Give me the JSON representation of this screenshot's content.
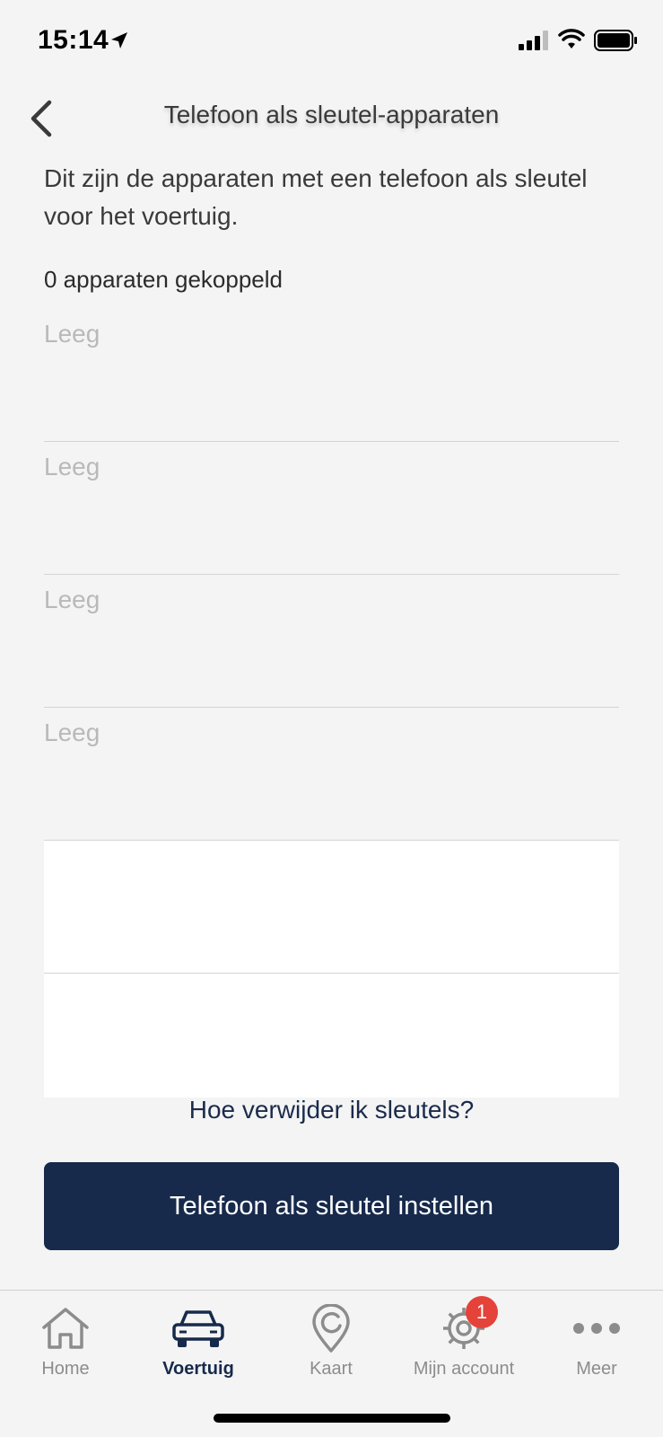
{
  "status_bar": {
    "time": "15:14"
  },
  "header": {
    "title": "Telefoon als sleutel-apparaten"
  },
  "description": "Dit zijn de apparaten met een telefoon als sleutel voor het voertuig.",
  "count_label": "0 apparaten gekoppeld",
  "slots": [
    {
      "label": "Leeg"
    },
    {
      "label": "Leeg"
    },
    {
      "label": "Leeg"
    },
    {
      "label": "Leeg"
    }
  ],
  "help_link": "Hoe verwijder ik sleutels?",
  "primary_button": "Telefoon als sleutel instellen",
  "tabs": [
    {
      "label": "Home",
      "icon": "home-icon"
    },
    {
      "label": "Voertuig",
      "icon": "car-icon",
      "active": true
    },
    {
      "label": "Kaart",
      "icon": "map-pin-icon"
    },
    {
      "label": "Mijn account",
      "icon": "gear-icon",
      "badge": "1"
    },
    {
      "label": "Meer",
      "icon": "more-icon"
    }
  ],
  "colors": {
    "brand": "#172a4c",
    "background": "#f4f4f4",
    "badge": "#e5423a"
  }
}
